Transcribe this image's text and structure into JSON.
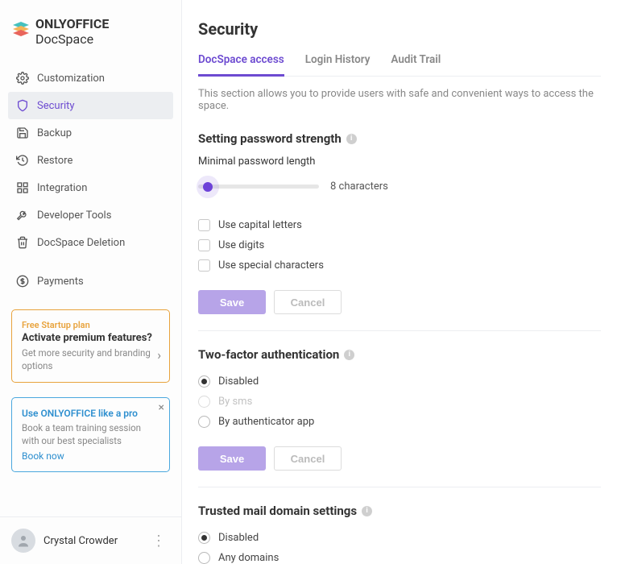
{
  "brand": {
    "name_bold": "ONLYOFFICE",
    "name_light": " DocSpace"
  },
  "sidebar": {
    "items": [
      {
        "label": "Customization"
      },
      {
        "label": "Security"
      },
      {
        "label": "Backup"
      },
      {
        "label": "Restore"
      },
      {
        "label": "Integration"
      },
      {
        "label": "Developer Tools"
      },
      {
        "label": "DocSpace Deletion"
      },
      {
        "label": "Payments"
      }
    ],
    "promo1": {
      "tag": "Free Startup plan",
      "headline": "Activate premium features?",
      "sub": "Get more security and branding options"
    },
    "promo2": {
      "headline": "Use ONLYOFFICE like a pro",
      "sub": "Book a team training session with our best specialists",
      "link": "Book now"
    }
  },
  "user": {
    "name": "Crystal Crowder"
  },
  "page": {
    "title": "Security",
    "tabs": [
      {
        "label": "DocSpace access"
      },
      {
        "label": "Login History"
      },
      {
        "label": "Audit Trail"
      }
    ],
    "desc": "This section allows you to provide users with safe and convenient ways to access the space.",
    "password": {
      "title": "Setting password strength",
      "min_label": "Minimal password length",
      "value_text": "8 characters",
      "checks": [
        {
          "label": "Use capital letters"
        },
        {
          "label": "Use digits"
        },
        {
          "label": "Use special characters"
        }
      ],
      "save": "Save",
      "cancel": "Cancel"
    },
    "tfa": {
      "title": "Two-factor authentication",
      "options": [
        {
          "label": "Disabled"
        },
        {
          "label": "By sms"
        },
        {
          "label": "By authenticator app"
        }
      ],
      "save": "Save",
      "cancel": "Cancel"
    },
    "trusted": {
      "title": "Trusted mail domain settings",
      "options": [
        {
          "label": "Disabled"
        },
        {
          "label": "Any domains"
        }
      ]
    }
  }
}
